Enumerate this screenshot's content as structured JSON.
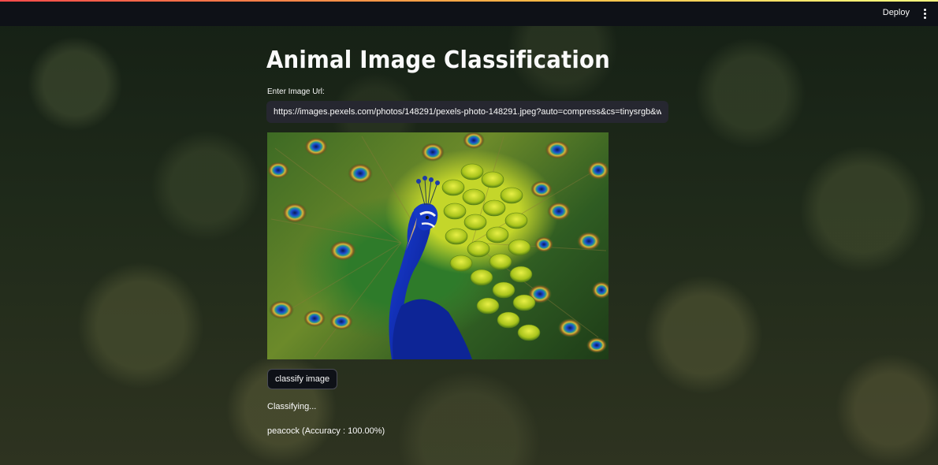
{
  "header": {
    "deploy_label": "Deploy",
    "menu_icon": "vertical-ellipsis-icon"
  },
  "main": {
    "title": "Animal Image Classification",
    "url_label": "Enter Image Url:",
    "url_value": "https://images.pexels.com/photos/148291/pexels-photo-148291.jpeg?auto=compress&cs=tinysrgb&w=",
    "image_subject": "peacock",
    "classify_button_label": "classify image",
    "status_text": "Classifying...",
    "result_text": "peacock (Accuracy : 100.00%)"
  },
  "colors": {
    "header_bg": "#0e1117",
    "input_bg": "#262730",
    "text": "#fafafa",
    "accent_gradient": [
      "#ff4b4b",
      "#ffbd45",
      "#fffd80"
    ]
  }
}
